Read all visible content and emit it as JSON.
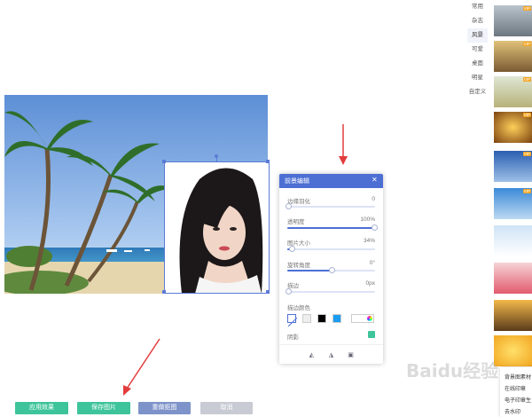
{
  "panel": {
    "title": "前景编辑",
    "sliders": [
      {
        "label": "边缘羽化",
        "value_text": "0",
        "fraction": 0.0
      },
      {
        "label": "透明度",
        "value_text": "100%",
        "fraction": 1.0
      },
      {
        "label": "图片大小",
        "value_text": "34%",
        "fraction": 0.05
      },
      {
        "label": "旋转角度",
        "value_text": "0°",
        "fraction": 0.5
      },
      {
        "label": "描边",
        "value_text": "0px",
        "fraction": 0.0
      }
    ],
    "stroke_color_label": "描边颜色",
    "stroke_colors": [
      "#ffffff",
      "#eeeeee",
      "#000000",
      "#1a9cf0",
      "#ffffff"
    ],
    "shadow_label": "阴影",
    "shadow_toggle_color": "#3ec49a"
  },
  "buttons": {
    "apply": "应用效果",
    "save": "保存图片",
    "redo": "重做抠图",
    "cancel": "取消"
  },
  "sidebar": {
    "tabs": [
      "常用",
      "杂志",
      "风景",
      "可爱",
      "桌面",
      "明星",
      "自定义"
    ],
    "active_tab": 2
  },
  "thumb_badge": "VIP",
  "bottom_menu": [
    "背景图素材",
    "在线印章",
    "电子印章生",
    "去水印"
  ],
  "watermark": "Baidu经验",
  "colors": {
    "accent": "#4d6fd4",
    "btn_green": "#3ec49a",
    "btn_blue": "#7d93c9",
    "btn_gray": "#c8cbd3",
    "arrow_red": "#e23c3c"
  }
}
